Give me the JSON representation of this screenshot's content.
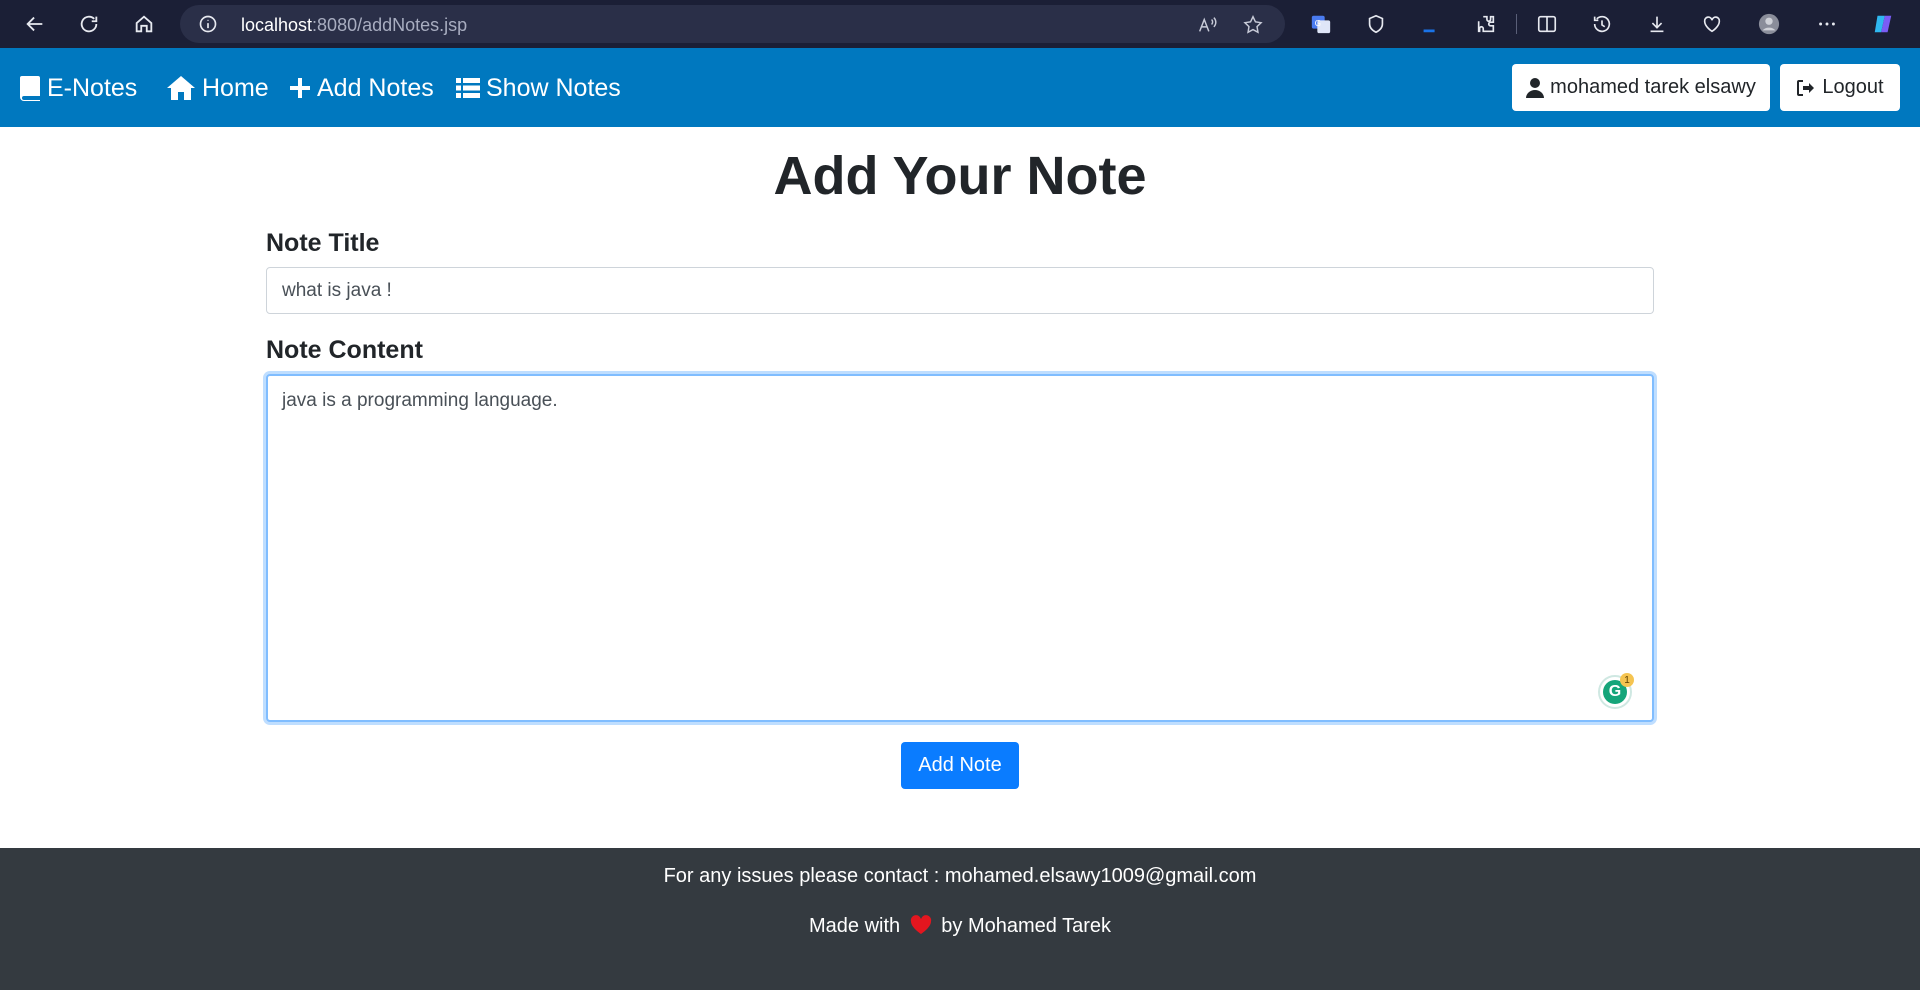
{
  "browser": {
    "url_host": "localhost",
    "url_path": ":8080/addNotes.jsp"
  },
  "navbar": {
    "brand": "E-Notes",
    "links": [
      {
        "label": "Home",
        "icon": "home-icon"
      },
      {
        "label": "Add Notes",
        "icon": "plus-icon"
      },
      {
        "label": "Show Notes",
        "icon": "list-icon"
      }
    ],
    "user_label": "mohamed tarek elsawy",
    "logout_label": "Logout"
  },
  "main": {
    "title": "Add Your Note",
    "note_title_label": "Note Title",
    "note_title_value": "what is java !",
    "note_content_label": "Note Content",
    "note_content_value": "java is a programming language.",
    "grammarly_count": "1",
    "add_button": "Add Note"
  },
  "footer": {
    "contact_text": "For any issues please contact : mohamed.elsawy1009@gmail.com",
    "made_with_prefix": "Made with",
    "made_with_suffix": "by Mohamed Tarek"
  },
  "colors": {
    "navbar": "#0078bf",
    "primary_button": "#0a7cff",
    "footer": "#343a40",
    "heart": "#e3161f"
  }
}
